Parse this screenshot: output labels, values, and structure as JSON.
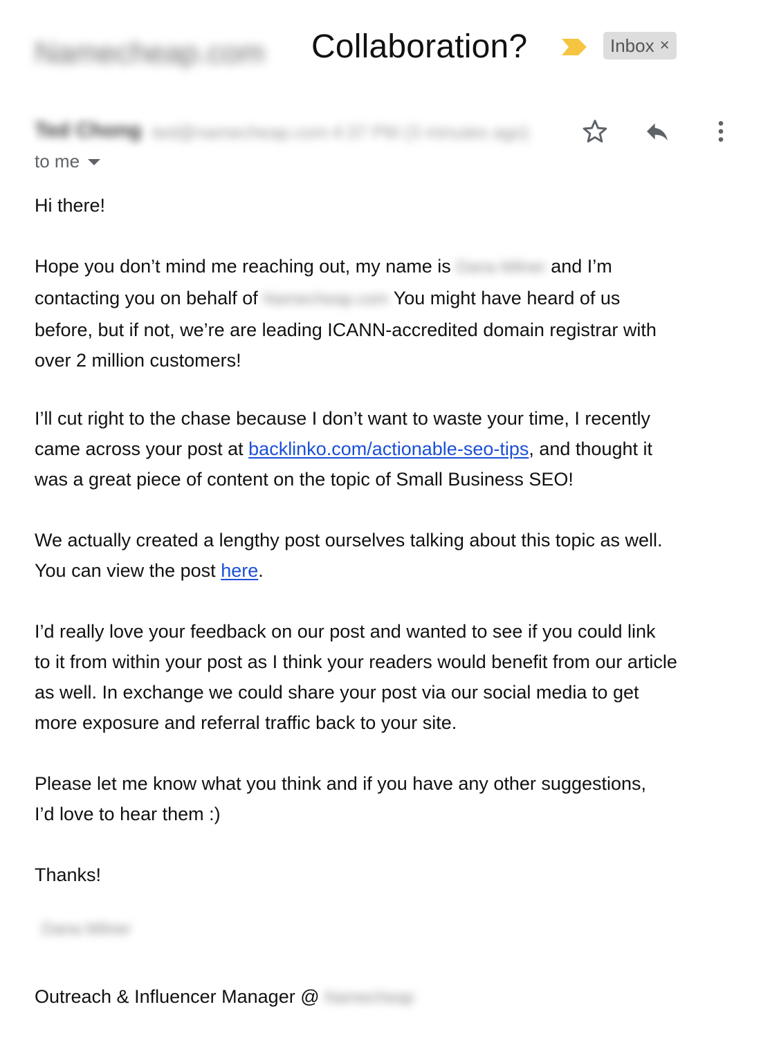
{
  "header": {
    "sender_domain_redacted": "Namecheap.com",
    "subject": "Collaboration?",
    "label_chip": "Inbox",
    "label_chip_close": "×",
    "importance_marker_color": "#f5c542"
  },
  "sender": {
    "name_redacted": "Ted Chong",
    "email_redacted": "ted@namecheap.com",
    "time_redacted": "4:37 PM (3 minutes ago)",
    "to_label": "to me"
  },
  "icons": {
    "star": "star-icon",
    "reply": "reply-icon",
    "more": "more-vert-icon",
    "caret": "chevron-down-icon"
  },
  "body": {
    "greeting": "Hi there!",
    "p1": {
      "l1_a": "Hope you don’t mind me reaching out, my name is",
      "l1_redacted": "Dana Milner",
      "l1_b": "and I’m",
      "l2_a": "contacting you on behalf of",
      "l2_redacted": "Namecheap.com",
      "l2_b": "You might have heard of us",
      "l3": "before, but if not, we’re are leading ICANN-accredited domain registrar with",
      "l4": "over 2 million customers!"
    },
    "p2": {
      "l1": "I’ll cut right to the chase because I don’t want to waste your time, I recently",
      "l2_a": "came across your post at",
      "l2_link": "backlinko.com/actionable-seo-tips",
      "l2_b": ", and thought it",
      "l3": "was a great piece of content on the topic of Small Business SEO!"
    },
    "p3": {
      "l1": "We actually created a lengthy post ourselves talking about this topic as well.",
      "l2_a": "You can view the post",
      "l2_link": "here",
      "l2_b": "."
    },
    "p4": {
      "l1": "I’d really love your feedback on our post and wanted to see if you could link",
      "l2": "to it from within your post as I think your readers would benefit from our article",
      "l3": "as well. In exchange we could share your post via our social media to get",
      "l4": "more exposure and referral traffic back to your site."
    },
    "p5": {
      "l1": "Please let me know what you think and if you have any other suggestions,",
      "l2": "I’d love to hear them :)"
    },
    "closing": "Thanks!",
    "signature_name_redacted": "Dana Milner",
    "signature_title": "Outreach & Influencer Manager @",
    "signature_company_redacted": "Namecheap"
  },
  "colors": {
    "link": "#1a4fd6",
    "chip_bg": "#dddddd",
    "icon": "#5f6368"
  }
}
